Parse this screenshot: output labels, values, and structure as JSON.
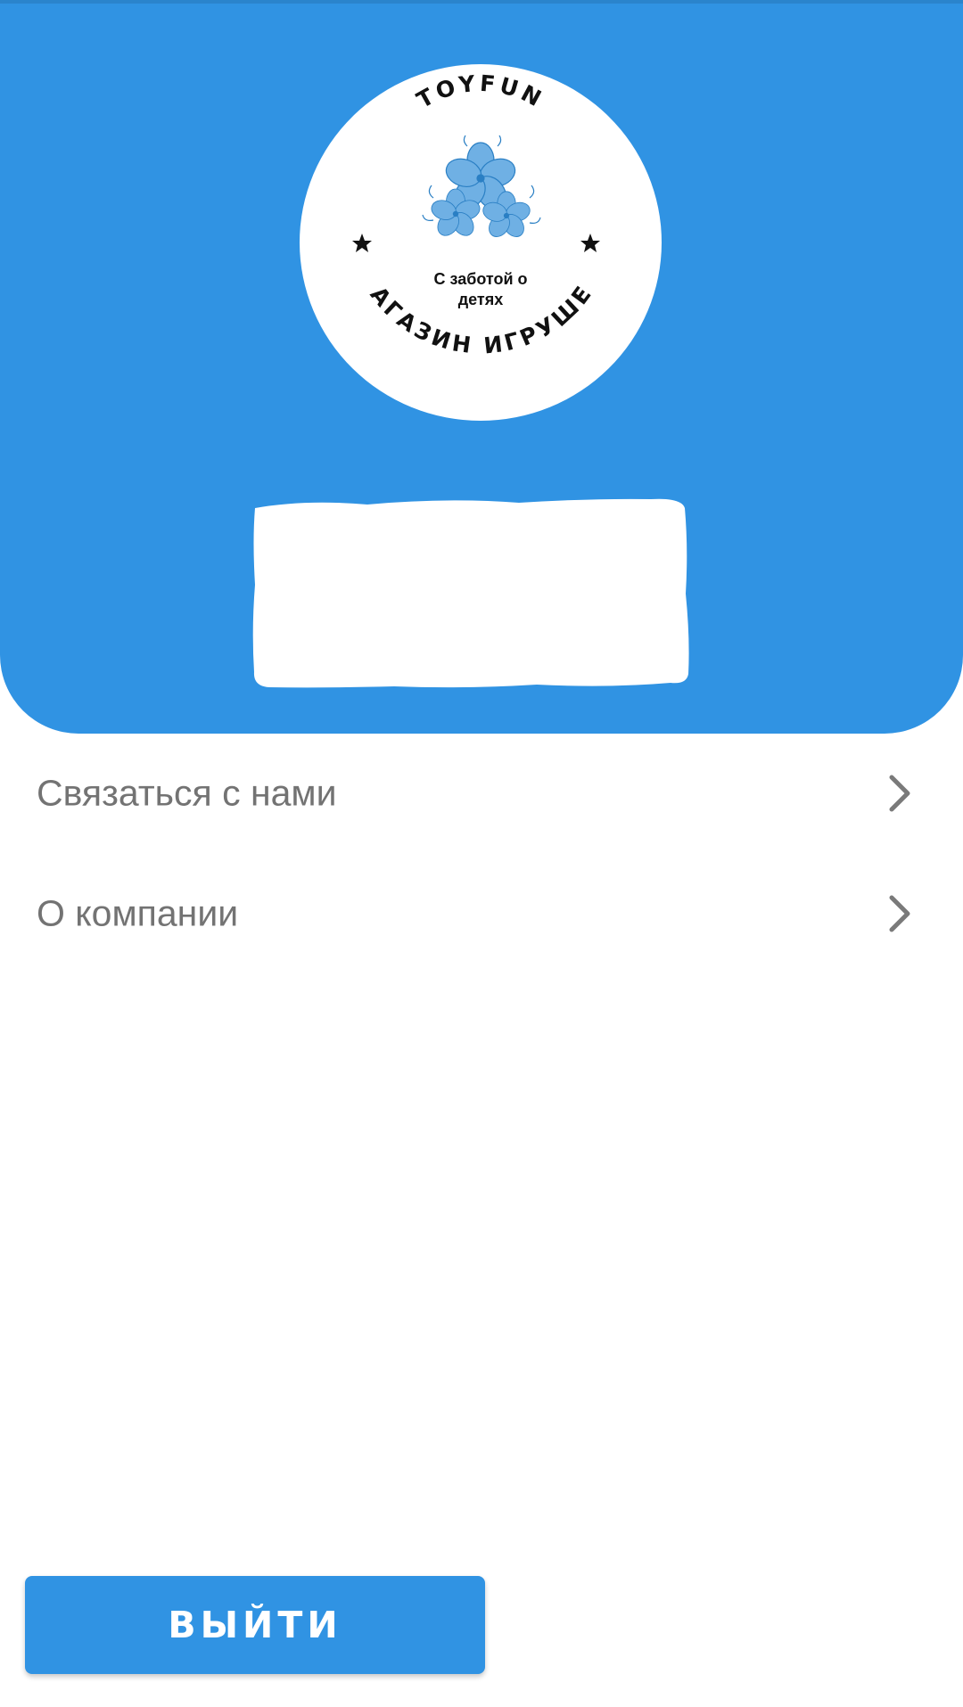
{
  "header": {
    "background_color": "#3093e3",
    "logo": {
      "top_text": "TOYFUN",
      "tagline_line1": "С заботой о",
      "tagline_line2": "детях",
      "bottom_text": "МАГАЗИН ИГРУШЕК",
      "icon": "flower-icon",
      "flower_color": "#6fb0e4"
    },
    "profile_card_color": "#ffffff"
  },
  "menu": {
    "items": [
      {
        "label": "Связаться с нами",
        "icon": "chevron-right-icon"
      },
      {
        "label": "О компании",
        "icon": "chevron-right-icon"
      }
    ],
    "text_color": "#737373"
  },
  "logout_button": {
    "label": "ВЫЙТИ",
    "color": "#3093e3"
  }
}
